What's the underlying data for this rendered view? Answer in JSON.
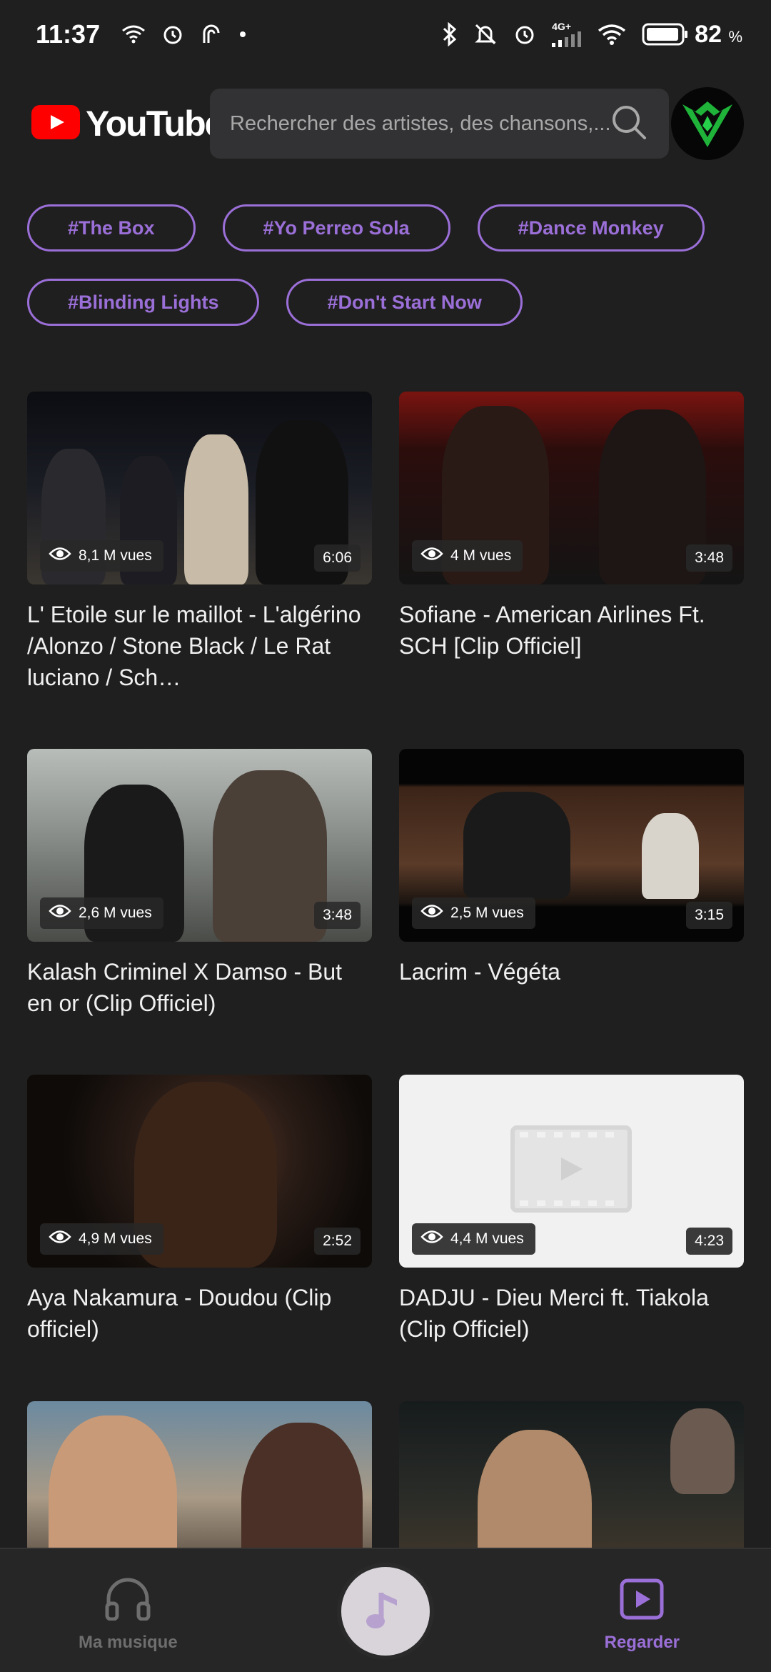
{
  "status_bar": {
    "time": "11:37",
    "battery_percent": "82",
    "battery_unit": "%",
    "network": "4G+",
    "icons": [
      "wifi-icon",
      "alarm-icon",
      "nfc-icon",
      "dot-icon",
      "bluetooth-icon",
      "mute-icon",
      "alarm-icon",
      "signal-icon",
      "wifi-icon",
      "battery-icon"
    ]
  },
  "header": {
    "logo_text": "YouTube",
    "search_placeholder": "Rechercher des artistes, des chansons,..."
  },
  "chips": [
    {
      "label": "#The Box"
    },
    {
      "label": "#Yo Perreo Sola"
    },
    {
      "label": "#Dance Monkey"
    },
    {
      "label": "#Blinding Lights"
    },
    {
      "label": "#Don't Start Now"
    }
  ],
  "videos": [
    {
      "title": "L' Etoile sur le maillot - L'algérino /Alonzo / Stone Black / Le Rat luciano / Sch…",
      "views": "8,1 M vues",
      "duration": "6:06"
    },
    {
      "title": "Sofiane - American Airlines Ft. SCH [Clip Officiel]",
      "views": "4 M vues",
      "duration": "3:48"
    },
    {
      "title": "Kalash Criminel X Damso - But en or (Clip Officiel)",
      "views": "2,6 M vues",
      "duration": "3:48"
    },
    {
      "title": "Lacrim - Végéta",
      "views": "2,5 M vues",
      "duration": "3:15"
    },
    {
      "title": "Aya Nakamura - Doudou (Clip officiel)",
      "views": "4,9 M vues",
      "duration": "2:52"
    },
    {
      "title": "DADJU - Dieu Merci ft. Tiakola (Clip Officiel)",
      "views": "4,4 M vues",
      "duration": "4:23"
    }
  ],
  "bottom_nav": {
    "my_music_label": "Ma musique",
    "watch_label": "Regarder"
  },
  "colors": {
    "background": "#1f1f1f",
    "accent": "#9b6fd8",
    "youtube_red": "#ff0000",
    "search_bg": "#323234"
  }
}
